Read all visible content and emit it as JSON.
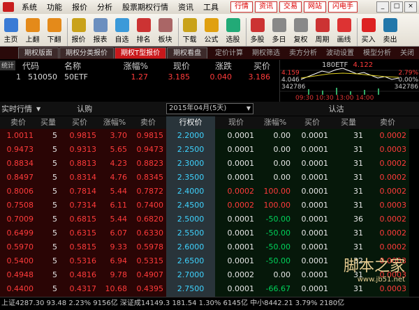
{
  "menu": [
    "系统",
    "功能",
    "报价",
    "分析",
    "股票期权行情",
    "资讯",
    "工具"
  ],
  "quick_links": [
    "行情",
    "资讯",
    "交易",
    "网站",
    "闪电手"
  ],
  "window_controls": [
    "_",
    "□",
    "×"
  ],
  "toolbar": [
    {
      "label": "主页",
      "icon": "home-icon",
      "color": "#3a7bd5"
    },
    {
      "label": "上翻",
      "icon": "arrow-up-icon",
      "color": "#e48a1a"
    },
    {
      "label": "下翻",
      "icon": "arrow-down-icon",
      "color": "#e48a1a"
    },
    {
      "label": "报价",
      "icon": "quote-icon",
      "color": "#c9a21a"
    },
    {
      "label": "报表",
      "icon": "report-icon",
      "color": "#6b8fbf"
    },
    {
      "label": "自选",
      "icon": "favorite-icon",
      "color": "#3b9ad9"
    },
    {
      "label": "排名",
      "icon": "rank-icon",
      "color": "#c33"
    },
    {
      "label": "板块",
      "icon": "sector-icon",
      "color": "#a66"
    },
    {
      "label": "下载",
      "icon": "download-icon",
      "color": "#c9a21a"
    },
    {
      "label": "公式",
      "icon": "formula-icon",
      "color": "#e0a010"
    },
    {
      "label": "选股",
      "icon": "stock-pick-icon",
      "color": "#2a7"
    },
    {
      "label": "多股",
      "icon": "multi-stock-icon",
      "color": "#c33"
    },
    {
      "label": "多日",
      "icon": "multi-day-icon",
      "color": "#888"
    },
    {
      "label": "复权",
      "icon": "adjust-icon",
      "color": "#888"
    },
    {
      "label": "周期",
      "icon": "period-icon",
      "color": "#c33"
    },
    {
      "label": "画线",
      "icon": "draw-line-icon",
      "color": "#d33"
    },
    {
      "label": "买入",
      "icon": "buy-icon",
      "color": "#d22"
    },
    {
      "label": "卖出",
      "icon": "sell-icon",
      "color": "#27a"
    }
  ],
  "tabs": [
    "期权版面",
    "期权分类报价",
    "期权T型报价",
    "期权看盘"
  ],
  "active_tab": 2,
  "tab_links": [
    "定价计算",
    "期权筛选",
    "卖方分析",
    "波动设置",
    "模型分析",
    "关闭"
  ],
  "quote": {
    "headers": [
      "统计",
      "代码",
      "名称",
      "涨幅%",
      "现价",
      "涨跌",
      "买价"
    ],
    "row": {
      "idx": "1",
      "code": "510050",
      "name": "50ETF",
      "pct": "1.27",
      "price": "3.185",
      "chg": "0.040",
      "bid": "3.186"
    }
  },
  "mini": {
    "title": "180ETF",
    "price": "4.122",
    "left": [
      "4.159",
      "4.046",
      "342786"
    ],
    "right": [
      "2.79%",
      "0.00%",
      "342786"
    ],
    "time": "09:30 10:30 13:00 14:00"
  },
  "tquote": {
    "left_label": "实时行情",
    "call_label": "认购",
    "date": "2015年04月(5天)",
    "put_label": "认沽",
    "columns": [
      "卖价",
      "买量",
      "买价",
      "涨幅%",
      "卖价",
      "行权价",
      "现价",
      "涨幅%",
      "买价",
      "买量",
      "卖价"
    ]
  },
  "rows": [
    [
      "1.0011",
      "5",
      "0.9815",
      "3.70",
      "0.9815",
      "2.2000",
      "0.0001",
      "0.00",
      "0.0001",
      "31",
      "0.0002"
    ],
    [
      "0.9473",
      "5",
      "0.9313",
      "5.65",
      "0.9473",
      "2.2500",
      "0.0001",
      "0.00",
      "0.0001",
      "31",
      "0.0003"
    ],
    [
      "0.8834",
      "5",
      "0.8813",
      "4.23",
      "0.8823",
      "2.3000",
      "0.0001",
      "0.00",
      "0.0001",
      "31",
      "0.0002"
    ],
    [
      "0.8497",
      "5",
      "0.8314",
      "4.76",
      "0.8345",
      "2.3500",
      "0.0001",
      "0.00",
      "0.0001",
      "31",
      "0.0002"
    ],
    [
      "0.8006",
      "5",
      "0.7814",
      "5.44",
      "0.7872",
      "2.4000",
      "0.0002",
      "100.00",
      "0.0001",
      "31",
      "0.0002"
    ],
    [
      "0.7508",
      "5",
      "0.7314",
      "6.11",
      "0.7400",
      "2.4500",
      "0.0002",
      "100.00",
      "0.0001",
      "31",
      "0.0003"
    ],
    [
      "0.7009",
      "5",
      "0.6815",
      "5.44",
      "0.6820",
      "2.5000",
      "0.0001",
      "-50.00",
      "0.0001",
      "36",
      "0.0002"
    ],
    [
      "0.6499",
      "5",
      "0.6315",
      "6.07",
      "0.6330",
      "2.5500",
      "0.0001",
      "-50.00",
      "0.0001",
      "31",
      "0.0002"
    ],
    [
      "0.5970",
      "5",
      "0.5815",
      "9.33",
      "0.5978",
      "2.6000",
      "0.0001",
      "-50.00",
      "0.0001",
      "31",
      "0.0002"
    ],
    [
      "0.5400",
      "5",
      "0.5316",
      "6.94",
      "0.5315",
      "2.6500",
      "0.0001",
      "-50.00",
      "0.0001",
      "32",
      "0.0003"
    ],
    [
      "0.4948",
      "5",
      "0.4816",
      "9.78",
      "0.4907",
      "2.7000",
      "0.0002",
      "0.00",
      "0.0001",
      "31",
      "0.0003"
    ],
    [
      "0.4400",
      "5",
      "0.4317",
      "10.68",
      "0.4395",
      "2.7500",
      "0.0001",
      "-66.67",
      "0.0001",
      "31",
      "0.0003"
    ],
    [
      "0.3902",
      "14",
      "0.3760",
      "8.36",
      "0.3760",
      "2.8000",
      "0.0004",
      "33.33",
      "0.0003",
      "15",
      "0.0004"
    ]
  ],
  "status": "上证4287.30  93.48  2.23%   9156亿   深证成14149.3 181.54 1.30%   6145亿   中小8442.21   3.79%  2180亿",
  "watermark": {
    "title": "脚本之家",
    "sub": "www.jb51.net"
  },
  "colors": {
    "up": "#ff3b3b",
    "down": "#00d25a",
    "neutral": "#e6e6e6",
    "strike": "#3fd3ff",
    "yellow": "#f0e060"
  }
}
